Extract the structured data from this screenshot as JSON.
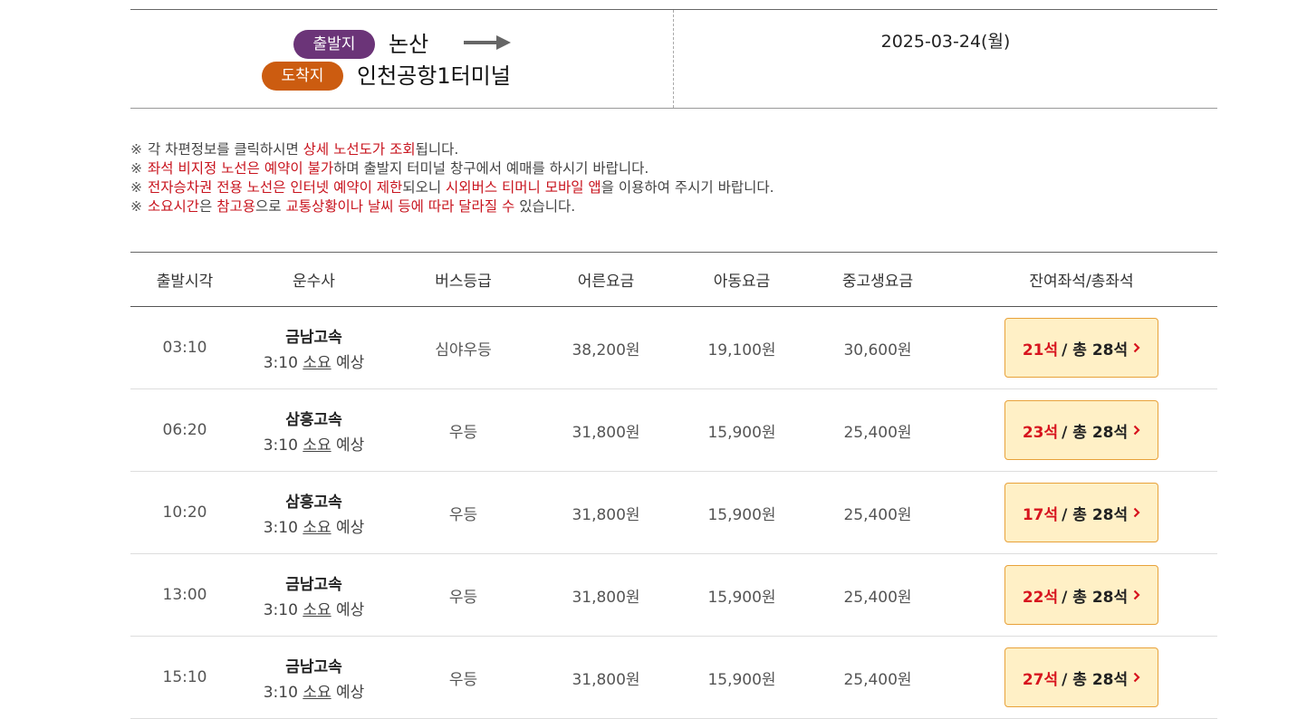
{
  "route": {
    "departure_badge": "출발지",
    "departure": "논산",
    "arrival_badge": "도착지",
    "arrival": "인천공항1터미널",
    "date": "2025-03-24(월)"
  },
  "notices": [
    {
      "segments": [
        {
          "text": "각 차편정보를 클릭하시면 ",
          "red": false
        },
        {
          "text": "상세 노선도가 조회",
          "red": true
        },
        {
          "text": "됩니다.",
          "red": false
        }
      ]
    },
    {
      "segments": [
        {
          "text": "좌석 비지정 노선은 예약이 불가",
          "red": true
        },
        {
          "text": "하며 출발지 터미널 창구에서 예매를 하시기 바랍니다.",
          "red": false
        }
      ]
    },
    {
      "segments": [
        {
          "text": "전자승차권 전용 노선은 인터넷 예약이 제한",
          "red": true
        },
        {
          "text": "되오니 ",
          "red": false
        },
        {
          "text": "시외버스 티머니 모바일 앱",
          "red": true
        },
        {
          "text": "을 이용하여 주시기 바랍니다.",
          "red": false
        }
      ]
    },
    {
      "segments": [
        {
          "text": "소요시간",
          "red": true
        },
        {
          "text": "은 ",
          "red": false
        },
        {
          "text": "참고용",
          "red": true
        },
        {
          "text": "으로 ",
          "red": false
        },
        {
          "text": "교통상황이나 날씨 등에 따라 달라질 수",
          "red": true
        },
        {
          "text": " 있습니다.",
          "red": false
        }
      ]
    }
  ],
  "notice_mark": "※",
  "table": {
    "headers": {
      "depart_time": "출발시각",
      "company": "운수사",
      "bus_class": "버스등급",
      "adult_fare": "어른요금",
      "child_fare": "아동요금",
      "youth_fare": "중고생요금",
      "seats": "잔여좌석/총좌석"
    },
    "duration_prefix": "3:10",
    "duration_soyo": "소요",
    "duration_suffix": "예상",
    "rows": [
      {
        "time": "03:10",
        "company": "금남고속",
        "duration": "3:10",
        "class": "심야우등",
        "adult": "38,200원",
        "child": "19,100원",
        "youth": "30,600원",
        "remaining": "21석",
        "total": "/ 총 28석"
      },
      {
        "time": "06:20",
        "company": "삼흥고속",
        "duration": "3:10",
        "class": "우등",
        "adult": "31,800원",
        "child": "15,900원",
        "youth": "25,400원",
        "remaining": "23석",
        "total": "/ 총 28석"
      },
      {
        "time": "10:20",
        "company": "삼흥고속",
        "duration": "3:10",
        "class": "우등",
        "adult": "31,800원",
        "child": "15,900원",
        "youth": "25,400원",
        "remaining": "17석",
        "total": "/ 총 28석"
      },
      {
        "time": "13:00",
        "company": "금남고속",
        "duration": "3:10",
        "class": "우등",
        "adult": "31,800원",
        "child": "15,900원",
        "youth": "25,400원",
        "remaining": "22석",
        "total": "/ 총 28석"
      },
      {
        "time": "15:10",
        "company": "금남고속",
        "duration": "3:10",
        "class": "우등",
        "adult": "31,800원",
        "child": "15,900원",
        "youth": "25,400원",
        "remaining": "27석",
        "total": "/ 총 28석"
      }
    ]
  },
  "colors": {
    "departure_badge": "#6b3478",
    "arrival_badge": "#cc5c10",
    "highlight_red": "#c8141e",
    "seat_button_bg": "#fff0c6",
    "seat_button_border": "#e8a23a"
  },
  "icons": {
    "route_arrow": "right-arrow-icon",
    "seat_chevron": "chevron-right-icon"
  }
}
